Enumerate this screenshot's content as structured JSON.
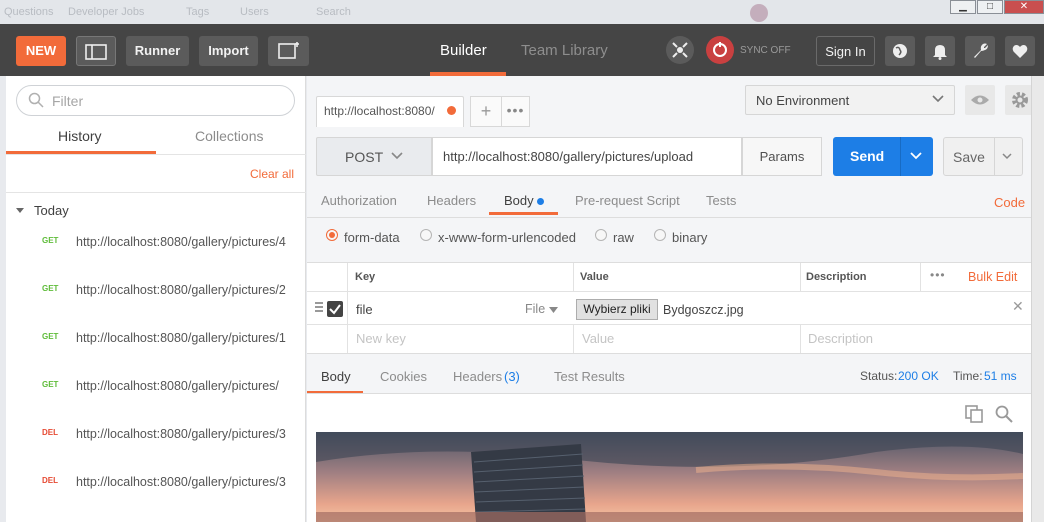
{
  "background_browser": {
    "items": [
      "Questions",
      "Developer Jobs",
      "Tags",
      "Users",
      "Search"
    ]
  },
  "toolbar": {
    "new_label": "NEW",
    "runner_label": "Runner",
    "import_label": "Import",
    "tab_builder": "Builder",
    "tab_team_library": "Team Library",
    "sync_label": "SYNC OFF",
    "signin_label": "Sign In"
  },
  "sidebar": {
    "search_placeholder": "Filter",
    "tab_history": "History",
    "tab_collections": "Collections",
    "clear_all": "Clear all",
    "group_label": "Today",
    "items": [
      {
        "method": "GET",
        "url": "http://localhost:8080/gallery/pictures/4"
      },
      {
        "method": "GET",
        "url": "http://localhost:8080/gallery/pictures/2"
      },
      {
        "method": "GET",
        "url": "http://localhost:8080/gallery/pictures/1"
      },
      {
        "method": "GET",
        "url": "http://localhost:8080/gallery/pictures/"
      },
      {
        "method": "DEL",
        "url": "http://localhost:8080/gallery/pictures/3"
      },
      {
        "method": "DEL",
        "url": "http://localhost:8080/gallery/pictures/3"
      }
    ]
  },
  "request": {
    "tab_title": "http://localhost:8080/",
    "environment": "No Environment",
    "method": "POST",
    "url": "http://localhost:8080/gallery/pictures/upload",
    "params_label": "Params",
    "send_label": "Send",
    "save_label": "Save",
    "subtabs": [
      "Authorization",
      "Headers",
      "Body",
      "Pre-request Script",
      "Tests"
    ],
    "code_label": "Code",
    "body_modes": [
      "form-data",
      "x-www-form-urlencoded",
      "raw",
      "binary"
    ],
    "table_headers": {
      "key": "Key",
      "value": "Value",
      "description": "Description",
      "bulk_edit": "Bulk Edit"
    },
    "row": {
      "key": "file",
      "type": "File",
      "choose_label": "Wybierz pliki",
      "filename": "Bydgoszcz.jpg"
    },
    "new_key_placeholder": "New key",
    "value_placeholder": "Value",
    "description_placeholder": "Description"
  },
  "response": {
    "tabs": [
      "Body",
      "Cookies",
      "Headers",
      "Test Results"
    ],
    "headers_count": "(3)",
    "status_label": "Status:",
    "status_value": "200 OK",
    "time_label": "Time:",
    "time_value": "51 ms"
  },
  "colors": {
    "accent": "#f26b3a",
    "primary": "#1d7ee6",
    "topbar": "#454545",
    "get": "#5fbc3a",
    "del": "#e64a33"
  }
}
